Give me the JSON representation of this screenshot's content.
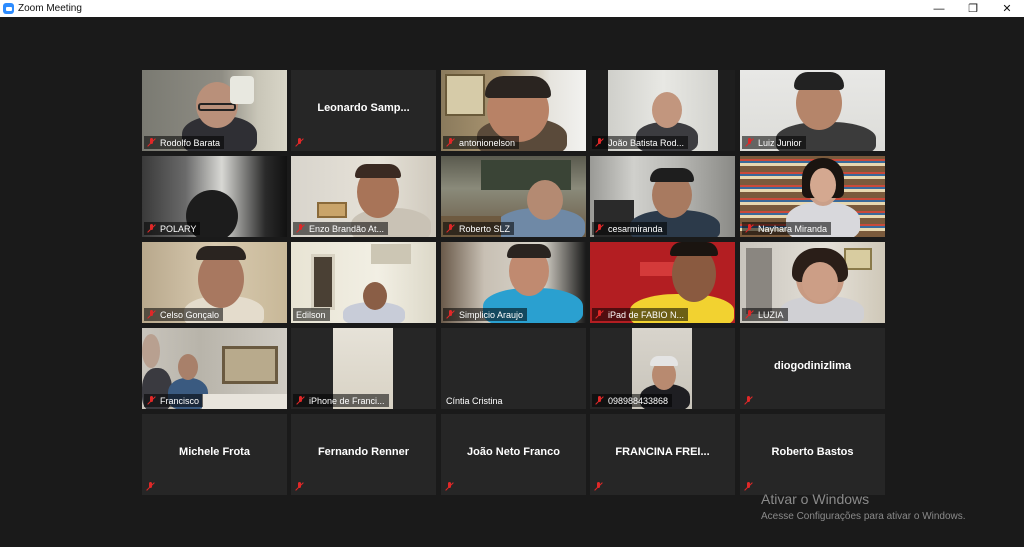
{
  "window": {
    "title": "Zoom Meeting",
    "minimize": "—",
    "restore": "❐",
    "close": "✕"
  },
  "participants": [
    {
      "name": "Rodolfo Barata",
      "video": true
    },
    {
      "name": "Leonardo  Samp...",
      "video": false
    },
    {
      "name": "antonionelson",
      "video": true
    },
    {
      "name": "João Batista Rod...",
      "video": true
    },
    {
      "name": "Luiz Junior",
      "video": true
    },
    {
      "name": "POLARY",
      "video": true
    },
    {
      "name": "Enzo Brandão At...",
      "video": true
    },
    {
      "name": "Roberto SLZ",
      "video": true
    },
    {
      "name": "cesarmiranda",
      "video": true
    },
    {
      "name": "Nayhara Miranda",
      "video": true
    },
    {
      "name": "Celso Gonçalo",
      "video": true
    },
    {
      "name": "Edilson",
      "video": true,
      "active_speaker": true
    },
    {
      "name": "Simplicio Araujo",
      "video": true
    },
    {
      "name": "iPad de FABIO N...",
      "video": true
    },
    {
      "name": "LUZIA",
      "video": true
    },
    {
      "name": "Francisco",
      "video": true
    },
    {
      "name": "iPhone de Franci...",
      "video": true
    },
    {
      "name": "Cíntia Cristina",
      "video": true
    },
    {
      "name": "098988433868",
      "video": true
    },
    {
      "name": "diogodinizlima",
      "video": false
    },
    {
      "name": "Michele Frota",
      "video": false
    },
    {
      "name": "Fernando Renner",
      "video": false
    },
    {
      "name": "João Neto Franco",
      "video": false
    },
    {
      "name": "FRANCINA FREI...",
      "video": false
    },
    {
      "name": "Roberto Bastos",
      "video": false
    }
  ],
  "watermark": {
    "title": "Ativar o Windows",
    "subtitle": "Acesse Configurações para ativar o Windows."
  },
  "colors": {
    "active_speaker_border": "#e8e33c",
    "muted_mic": "#e02828",
    "tile_bg": "#262626",
    "stage_bg": "#1a1a1a"
  }
}
